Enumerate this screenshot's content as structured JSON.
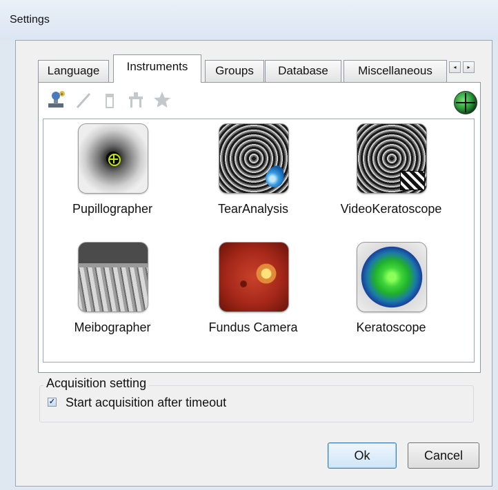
{
  "window": {
    "title": "Settings"
  },
  "tabs": [
    {
      "label": "Language",
      "active": false
    },
    {
      "label": "Instruments",
      "active": true
    },
    {
      "label": "Groups",
      "active": false
    },
    {
      "label": "Database",
      "active": false
    },
    {
      "label": "Miscellaneous",
      "active": false
    }
  ],
  "tab_scroll": {
    "left": "◂",
    "right": "▸"
  },
  "toolbar": {
    "icons": [
      "add-instrument-icon",
      "edit-pencil-icon",
      "delete-trash-icon",
      "workstation-icon",
      "favorite-star-icon",
      "globe-icon"
    ]
  },
  "instruments": [
    {
      "label": "Pupillographer"
    },
    {
      "label": "TearAnalysis"
    },
    {
      "label": "VideoKeratoscope"
    },
    {
      "label": "Meibographer"
    },
    {
      "label": "Fundus Camera"
    },
    {
      "label": "Keratoscope"
    }
  ],
  "acquisition": {
    "group_label": "Acquisition setting",
    "checkbox_label": "Start acquisition after timeout",
    "checked": true
  },
  "buttons": {
    "ok": "Ok",
    "cancel": "Cancel"
  }
}
